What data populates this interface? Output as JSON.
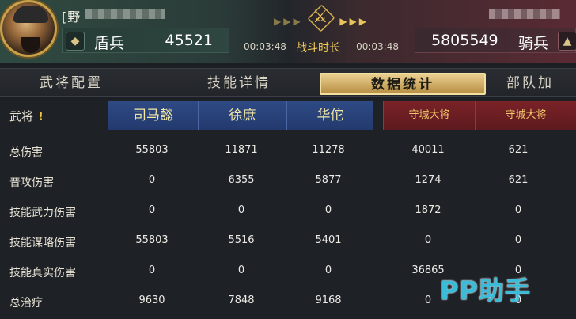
{
  "player_left": {
    "name": "[野",
    "troop_type": "盾兵",
    "troop_count": "45521"
  },
  "battle": {
    "timer_left": "00:03:48",
    "label": "战斗时长",
    "timer_right": "00:03:48"
  },
  "player_right": {
    "troop_count": "5805549",
    "troop_type": "骑兵"
  },
  "tabs": [
    "武将配置",
    "技能详情",
    "数据统计",
    "部队加"
  ],
  "active_tab": "数据统计",
  "table": {
    "header_label": "武将",
    "header_mark": "!",
    "columns": [
      {
        "name": "司马懿",
        "side": "ally"
      },
      {
        "name": "徐庶",
        "side": "ally"
      },
      {
        "name": "华佗",
        "side": "ally"
      },
      {
        "name": "守城大将",
        "side": "enemy"
      },
      {
        "name": "守城大将",
        "side": "enemy"
      }
    ],
    "rows": [
      {
        "label": "总伤害",
        "values": [
          "55803",
          "11871",
          "11278",
          "40011",
          "621"
        ]
      },
      {
        "label": "普攻伤害",
        "values": [
          "0",
          "6355",
          "5877",
          "1274",
          "621"
        ]
      },
      {
        "label": "技能武力伤害",
        "values": [
          "0",
          "0",
          "0",
          "1872",
          "0"
        ]
      },
      {
        "label": "技能谋略伤害",
        "values": [
          "55803",
          "5516",
          "5401",
          "0",
          "0"
        ]
      },
      {
        "label": "技能真实伤害",
        "values": [
          "0",
          "0",
          "0",
          "36865",
          "0"
        ]
      },
      {
        "label": "总治疗",
        "values": [
          "9630",
          "7848",
          "9168",
          "0",
          "0"
        ]
      }
    ]
  },
  "watermark": "PP助手",
  "colors": {
    "ally_header": "#2f4a84",
    "enemy_header": "#7a2227",
    "active_tab": "#e9cf8e",
    "accent_gold": "#f3cd5a"
  },
  "icons": [
    "avatar",
    "shield-emblem-icon",
    "crossed-swords-icon",
    "cavalry-emblem-icon",
    "arrow-right-icon"
  ]
}
